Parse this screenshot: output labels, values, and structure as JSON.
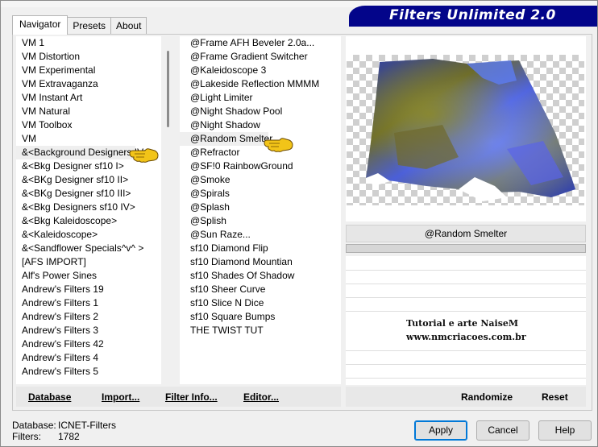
{
  "window": {
    "title": "Filters Unlimited 2.0"
  },
  "tabs": [
    {
      "label": "Navigator",
      "active": true
    },
    {
      "label": "Presets",
      "active": false
    },
    {
      "label": "About",
      "active": false
    }
  ],
  "categories": {
    "items": [
      "VM 1",
      "VM Distortion",
      "VM Experimental",
      "VM Extravaganza",
      "VM Instant Art",
      "VM Natural",
      "VM Toolbox",
      "VM",
      "&<Background Designers IV>",
      "&<Bkg Designer sf10 I>",
      "&<BKg Designer sf10 II>",
      "&<BKg Designer sf10 III>",
      "&<Bkg Designers sf10 IV>",
      "&<Bkg Kaleidoscope>",
      "&<Kaleidoscope>",
      "&<Sandflower Specials^v^ >",
      "[AFS IMPORT]",
      "Alf's Power Sines",
      "Andrew's Filters 19",
      "Andrew's Filters 1",
      "Andrew's Filters 2",
      "Andrew's Filters 3",
      "Andrew's Filters 42",
      "Andrew's Filters 4",
      "Andrew's Filters 5"
    ],
    "selected": "&<Background Designers IV>"
  },
  "filters": {
    "items": [
      "@Frame AFH Beveler 2.0a...",
      "@Frame Gradient Switcher",
      "@Kaleidoscope 3",
      "@Lakeside Reflection MMMM",
      "@Light Limiter",
      "@Night Shadow Pool",
      "@Night Shadow",
      "@Random Smelter",
      "@Refractor",
      "@SF!0 RainbowGround",
      "@Smoke",
      "@Spirals",
      "@Splash",
      "@Splish",
      "@Sun Raze...",
      "sf10 Diamond Flip",
      "sf10 Diamond Mountian",
      "sf10 Shades Of Shadow",
      "sf10 Sheer Curve",
      "sf10 Slice N Dice",
      "sf10 Square Bumps",
      "THE TWIST TUT"
    ],
    "selected": "@Random Smelter"
  },
  "preview": {
    "filter_name": "@Random Smelter"
  },
  "credits": {
    "line1": "Tutorial e arte NaiseM",
    "line2": "www.nmcriacoes.com.br"
  },
  "bottom_left_buttons": {
    "database": "Database",
    "import": "Import...",
    "filter_info": "Filter Info...",
    "editor": "Editor..."
  },
  "bottom_right_buttons": {
    "randomize": "Randomize",
    "reset": "Reset"
  },
  "status": {
    "database_label": "Database:",
    "database_value": "ICNET-Filters",
    "filters_label": "Filters:",
    "filters_value": "1782"
  },
  "dialog_buttons": {
    "apply": "Apply",
    "cancel": "Cancel",
    "help": "Help"
  },
  "colors": {
    "banner": "#03058a",
    "pointer_hand": "#f2c418",
    "selection": "#efefef",
    "default_button_border": "#0078d7"
  }
}
